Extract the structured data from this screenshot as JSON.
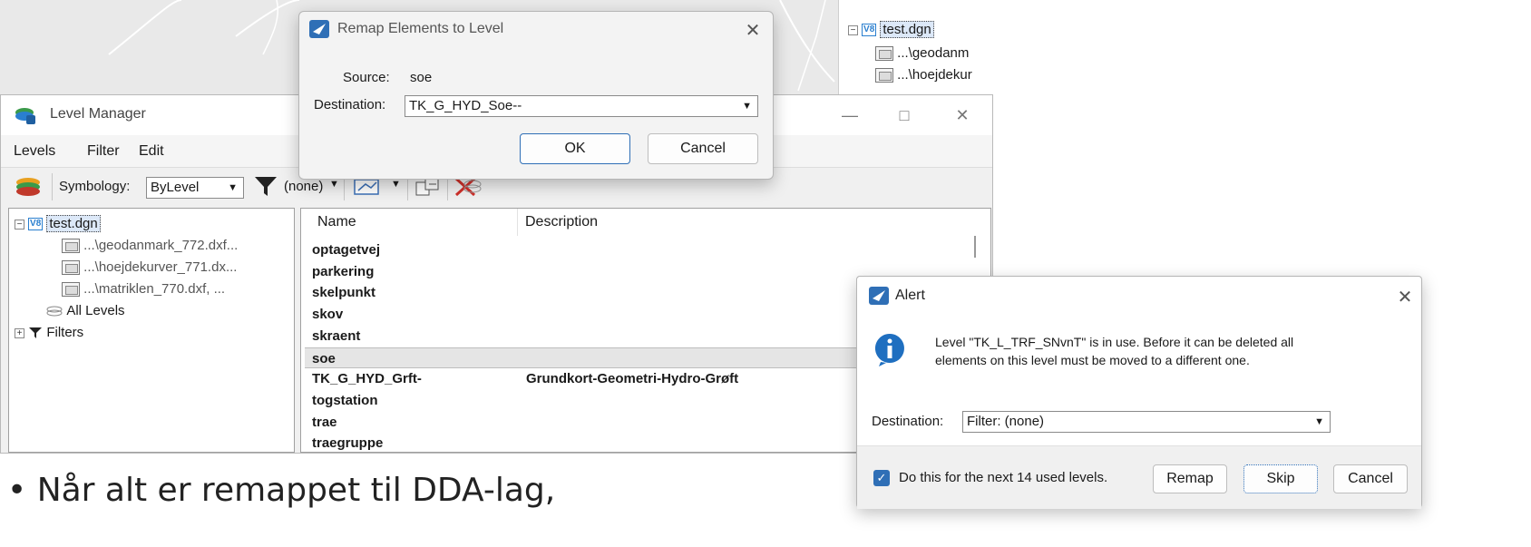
{
  "right_tree": {
    "root": "test.dgn",
    "refs": [
      "...\\geodanm",
      "...\\hoejdekur"
    ]
  },
  "level_manager": {
    "title": "Level Manager",
    "menu": {
      "levels": "Levels",
      "filter": "Filter",
      "edit": "Edit"
    },
    "toolbar": {
      "symbology_label": "Symbology:",
      "symbology_value": "ByLevel",
      "filter_value": "(none)"
    },
    "tree": {
      "root": "test.dgn",
      "refs": [
        "...\\geodanmark_772.dxf...",
        "...\\hoejdekurver_771.dx...",
        "...\\matriklen_770.dxf, ..."
      ],
      "all_levels": "All Levels",
      "filters": "Filters"
    },
    "columns": {
      "name": "Name",
      "description": "Description"
    },
    "rows": [
      {
        "name": "optagetvej",
        "description": ""
      },
      {
        "name": "parkering",
        "description": ""
      },
      {
        "name": "skelpunkt",
        "description": ""
      },
      {
        "name": "skov",
        "description": ""
      },
      {
        "name": "skraent",
        "description": ""
      },
      {
        "name": "soe",
        "description": ""
      },
      {
        "name": "TK_G_HYD_Grft-",
        "description": "Grundkort-Geometri-Hydro-Grøft"
      },
      {
        "name": "togstation",
        "description": ""
      },
      {
        "name": "trae",
        "description": ""
      },
      {
        "name": "traegruppe",
        "description": ""
      }
    ]
  },
  "remap_dialog": {
    "title": "Remap Elements to Level",
    "source_label": "Source:",
    "source_value": "soe",
    "destination_label": "Destination:",
    "destination_value": "TK_G_HYD_Soe--",
    "ok": "OK",
    "cancel": "Cancel"
  },
  "alert_dialog": {
    "title": "Alert",
    "message_line1": "Level \"TK_L_TRF_SNvnT\" is in use.  Before it can be deleted all",
    "message_line2": "elements on this level must be moved to a different one.",
    "destination_label": "Destination:",
    "destination_value": "Filter: (none)",
    "checkbox_label": "Do this for the next 14 used levels.",
    "checkbox_checked": true,
    "remap": "Remap",
    "skip": "Skip",
    "cancel": "Cancel"
  },
  "bullet_text": "Når alt er remappet til DDA-lag,",
  "colors": {
    "accent": "#2f6fb6",
    "selected_row": "#e5e5e5"
  }
}
